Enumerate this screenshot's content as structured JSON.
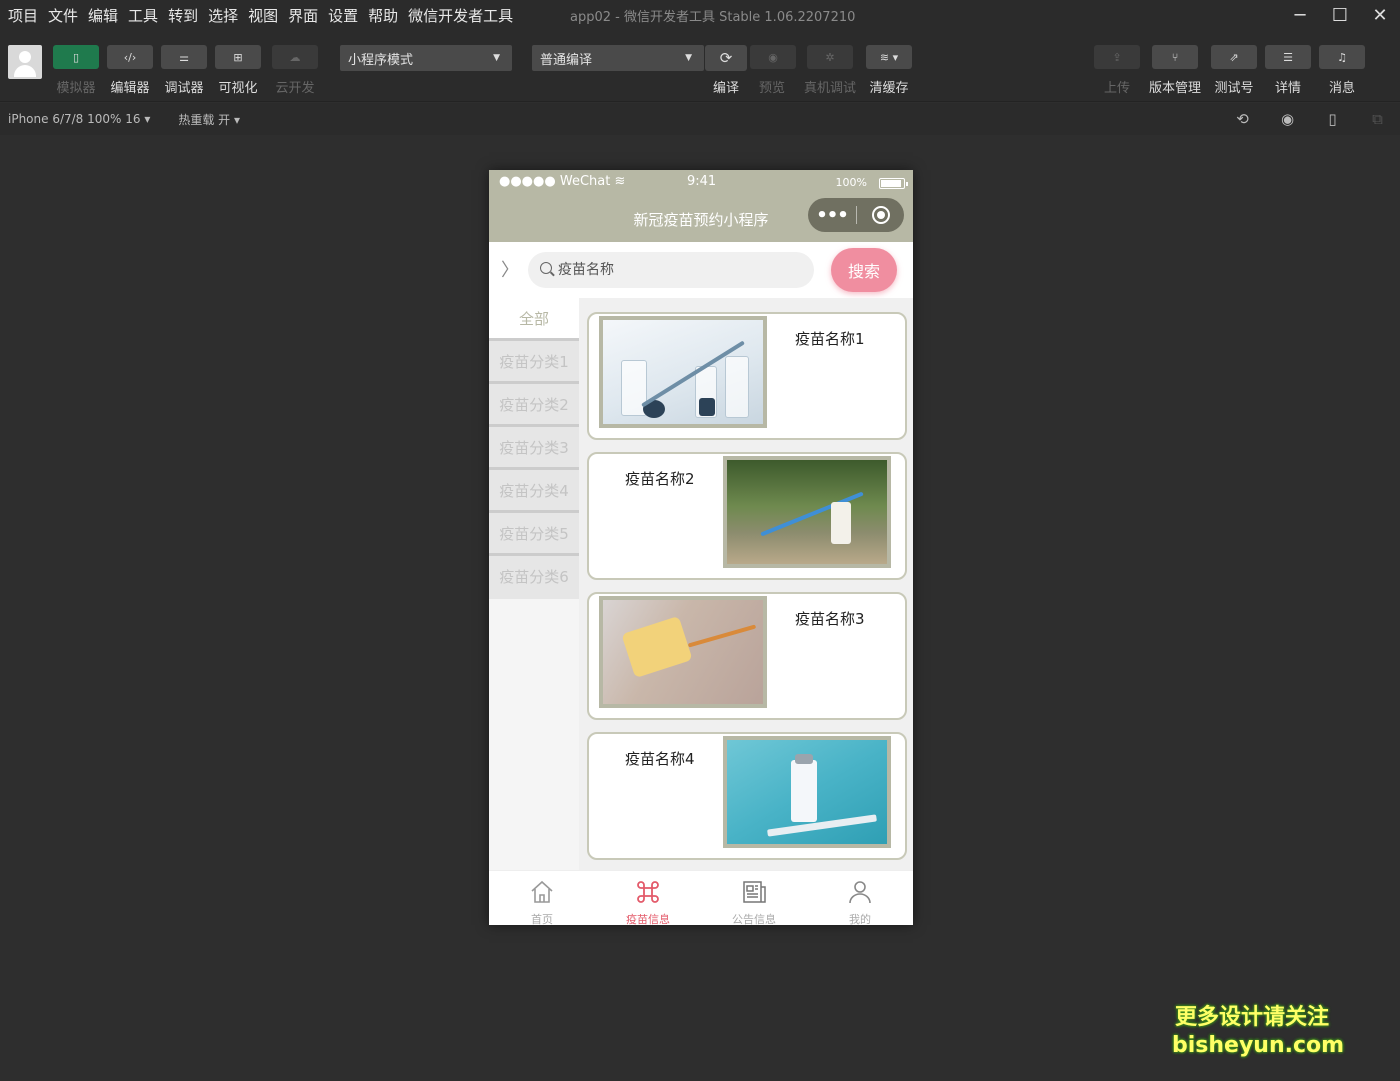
{
  "menu": [
    "项目",
    "文件",
    "编辑",
    "工具",
    "转到",
    "选择",
    "视图",
    "界面",
    "设置",
    "帮助",
    "微信开发者工具"
  ],
  "window": {
    "title": "app02 - 微信开发者工具 Stable 1.06.2207210"
  },
  "toolbar": {
    "simulator": "模拟器",
    "editor": "编辑器",
    "debugger": "调试器",
    "visual": "可视化",
    "cloud": "云开发",
    "mode_select": "小程序模式",
    "compile_select": "普通编译",
    "compile": "编译",
    "preview": "预览",
    "real_debug": "真机调试",
    "clear_cache": "清缓存",
    "upload": "上传",
    "version": "版本管理",
    "test_account": "测试号",
    "details": "详情",
    "messages": "消息"
  },
  "subbar": {
    "device": "iPhone 6/7/8 100% 16 ▾",
    "hot_reload": "热重载 开 ▾"
  },
  "phone": {
    "status_left": "●●●●● WeChat",
    "status_time": "9:41",
    "status_battery": "100%",
    "page_title": "新冠疫苗预约小程序",
    "search_placeholder": "疫苗名称",
    "search_button": "搜索",
    "categories": [
      "全部",
      "疫苗分类1",
      "疫苗分类2",
      "疫苗分类3",
      "疫苗分类4",
      "疫苗分类5",
      "疫苗分类6"
    ],
    "vaccines": [
      "疫苗名称1",
      "疫苗名称2",
      "疫苗名称3",
      "疫苗名称4"
    ],
    "tabs": [
      "首页",
      "疫苗信息",
      "公告信息",
      "我的"
    ]
  },
  "colors": {
    "nav_bg": "#b7b8a5",
    "search_button": "#f08ea0",
    "active_tab": "#e35a6a",
    "ide_bg": "#2e2e2e"
  },
  "watermark": {
    "line1": "更多设计请关注",
    "line2": "bisheyun.com"
  }
}
